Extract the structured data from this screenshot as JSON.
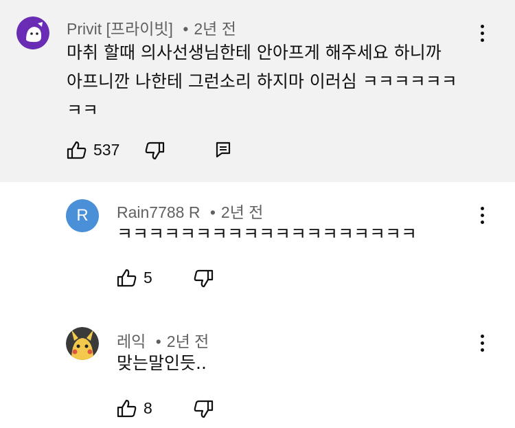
{
  "comments": [
    {
      "author": "Privit",
      "author_tag": "[프라이빗]",
      "time": "2년 전",
      "text_lines": [
        "마취 할때 의사선생님한테 안아프게 해주세요 하니까",
        "아프니깐 나한테 그런소리 하지마 이러심 ㅋㅋㅋㅋㅋㅋ",
        "ㅋㅋ"
      ],
      "likes": "537",
      "avatar_icon": "purple-ghost-avatar",
      "colors": {
        "background": "#f2f2f2",
        "avatar": "#6a2bb5"
      }
    },
    {
      "author": "Rain7788 R",
      "time": "2년 전",
      "text": "ㅋㅋㅋㅋㅋㅋㅋㅋㅋㅋㅋㅋㅋㅋㅋㅋㅋㅋㅋ",
      "likes": "5",
      "avatar_letter": "R",
      "colors": {
        "avatar": "#4a90d9"
      }
    },
    {
      "author": "레익",
      "time": "2년 전",
      "text": "맞는말인듯..",
      "likes": "8",
      "avatar_icon": "pikachu-avatar",
      "colors": {
        "avatar": "#f2c94c"
      }
    }
  ],
  "separator": "•",
  "icons": {
    "like": "thumbs-up-icon",
    "dislike": "thumbs-down-icon",
    "reply": "reply-icon",
    "more": "more-vert-icon"
  }
}
